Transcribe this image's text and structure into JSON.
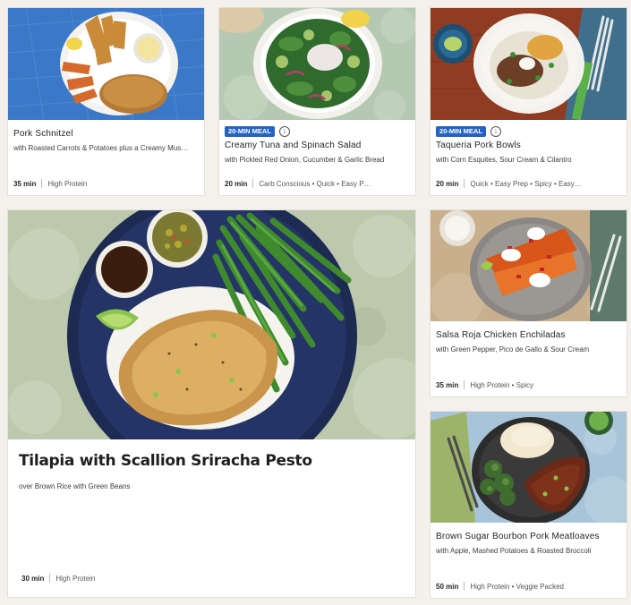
{
  "cards": [
    {
      "title": "Pork Schnitzel",
      "subtitle": "with Roasted Carrots & Potatoes plus a Creamy Mus…",
      "time": "35 min",
      "tags": "High Protein"
    },
    {
      "badge": "20-MIN MEAL",
      "info_icon": "i",
      "title": "Creamy Tuna and Spinach Salad",
      "subtitle": "with Pickled Red Onion, Cucumber & Garlic Bread",
      "time": "20 min",
      "tags": "Carb Conscious • Quick • Easy P…"
    },
    {
      "badge": "20-MIN MEAL",
      "info_icon": "i",
      "title": "Taqueria Pork Bowls",
      "subtitle": "with Corn Esquites, Sour Cream & Cilantro",
      "time": "20 min",
      "tags": "Quick • Easy Prep • Spicy • Easy…"
    },
    {
      "title": "Tilapia with Scallion Sriracha Pesto",
      "subtitle": "over Brown Rice with Green Beans",
      "time": "30 min",
      "tags": "High Protein"
    },
    {
      "title": "Salsa Roja Chicken Enchiladas",
      "subtitle": "with Green Pepper, Pico de Gallo & Sour Cream",
      "time": "35 min",
      "tags": "High Protein • Spicy"
    },
    {
      "title": "Brown Sugar Bourbon Pork Meatloaves",
      "subtitle": "with Apple, Mashed Potatoes & Roasted Broccoli",
      "time": "50 min",
      "tags": "High Protein • Veggie Packed"
    }
  ],
  "colors": {
    "page_bg": "#f4f1ec",
    "badge_blue": "#2463c6"
  }
}
